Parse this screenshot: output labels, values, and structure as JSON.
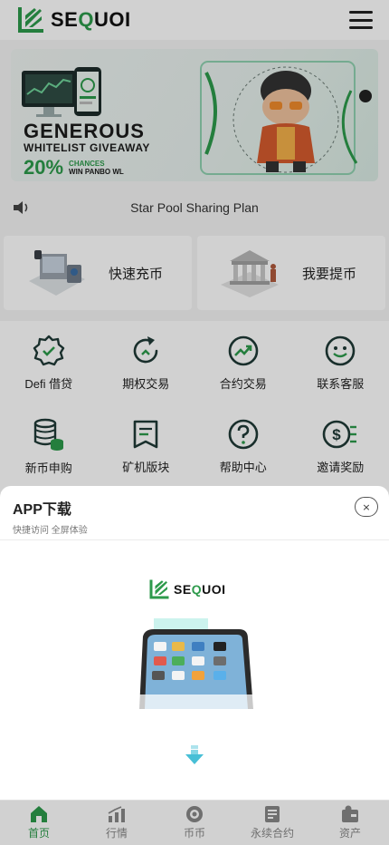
{
  "header": {
    "brand": "SEQUOI",
    "brand_prefix": "SE",
    "brand_q": "Q",
    "brand_suffix": "UOI"
  },
  "banner": {
    "title": "GENEROUS",
    "subtitle": "WHITELIST GIVEAWAY",
    "percent": "20%",
    "small_line1": "CHANCES",
    "small_line2": "WIN PANBO WL"
  },
  "notice": {
    "text": "Star Pool Sharing Plan"
  },
  "cards": [
    {
      "label": "快速充币",
      "icon": "deposit-illustration"
    },
    {
      "label": "我要提币",
      "icon": "withdraw-illustration"
    }
  ],
  "grid": [
    {
      "label": "Defi 借贷",
      "icon": "badge-check-icon"
    },
    {
      "label": "期权交易",
      "icon": "refresh-arrow-icon"
    },
    {
      "label": "合约交易",
      "icon": "trend-up-icon"
    },
    {
      "label": "联系客服",
      "icon": "smiley-icon"
    },
    {
      "label": "新币申购",
      "icon": "coins-stack-icon"
    },
    {
      "label": "矿机版块",
      "icon": "book-icon"
    },
    {
      "label": "帮助中心",
      "icon": "question-icon"
    },
    {
      "label": "邀请奖励",
      "icon": "dollar-list-icon"
    }
  ],
  "sheet": {
    "title": "APP下载",
    "subtitle": "快捷访问 全屏体验",
    "close": "×",
    "logo": "SEQUOI"
  },
  "tabs": [
    {
      "label": "首页",
      "icon": "home-icon",
      "active": true
    },
    {
      "label": "行情",
      "icon": "market-icon",
      "active": false
    },
    {
      "label": "币币",
      "icon": "coin-icon",
      "active": false
    },
    {
      "label": "永续合约",
      "icon": "contract-icon",
      "active": false
    },
    {
      "label": "资产",
      "icon": "assets-icon",
      "active": false
    }
  ],
  "colors": {
    "accent": "#2d9a4b",
    "dark": "#222222"
  }
}
